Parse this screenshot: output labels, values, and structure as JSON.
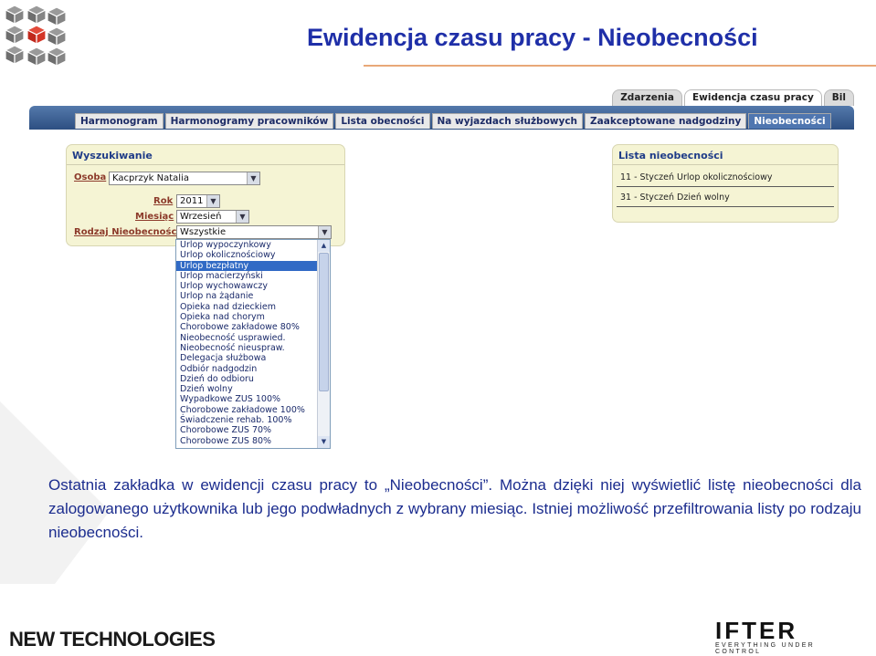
{
  "slide": {
    "title": "Ewidencja czasu pracy - Nieobecności",
    "paragraph": "Ostatnia zakładka w ewidencji czasu pracy to „Nieobecności”. Można dzięki niej wyświetlić listę nieobecności dla zalogowanego użytkownika lub jego podwładnych z wybrany miesiąc. Istniej możliwość przefiltrowania listy po rodzaju nieobecności.",
    "footer_left": "NEW TECHNOLOGIES",
    "footer_brand": "IFTER",
    "footer_tagline": "EVERYTHING UNDER CONTROL"
  },
  "app": {
    "top_tabs": [
      {
        "label": "Zdarzenia",
        "active": false
      },
      {
        "label": "Ewidencja czasu pracy",
        "active": true
      },
      {
        "label": "Bil",
        "active": false
      }
    ],
    "sub_tabs": [
      {
        "label": "Harmonogram",
        "active": false
      },
      {
        "label": "Harmonogramy pracowników",
        "active": false
      },
      {
        "label": "Lista obecności",
        "active": false
      },
      {
        "label": "Na wyjazdach służbowych",
        "active": false
      },
      {
        "label": "Zaakceptowane nadgodziny",
        "active": false
      },
      {
        "label": "Nieobecności",
        "active": true
      }
    ],
    "search": {
      "title": "Wyszukiwanie",
      "person_label": "Osoba",
      "person_value": "Kacprzyk Natalia",
      "year_label": "Rok",
      "year_value": "2011",
      "month_label": "Miesiąc",
      "month_value": "Wrzesień",
      "type_label": "Rodzaj Nieobecności",
      "type_value": "Wszystkie",
      "type_options": [
        "Urlop wypoczynkowy",
        "Urlop okolicznościowy",
        "Urlop bezpłatny",
        "Urlop macierzyński",
        "Urlop wychowawczy",
        "Urlop na żądanie",
        "Opieka nad dzieckiem",
        "Opieka nad chorym",
        "Chorobowe zakładowe 80%",
        "Nieobecność usprawied.",
        "Nieobecność nieuspraw.",
        "Delegacja służbowa",
        "Odbiór nadgodzin",
        "Dzień do odbioru",
        "Dzień wolny",
        "Wypadkowe ZUS 100%",
        "Chorobowe zakładowe 100%",
        "Świadczenie rehab. 100%",
        "Chorobowe ZUS 70%",
        "Chorobowe ZUS 80%"
      ],
      "highlighted_option": "Urlop bezpłatny"
    },
    "absences": {
      "title": "Lista nieobecności",
      "rows": [
        "11 - Styczeń Urlop okolicznościowy",
        "31 - Styczeń Dzień wolny"
      ]
    }
  },
  "colors": {
    "title": "#1f2fa8",
    "body_text": "#1b2c8e",
    "nav_bar": "#3b5f94",
    "panel_bg": "#f5f4d4",
    "selection": "#316ac5",
    "rule": "#e8a878"
  }
}
